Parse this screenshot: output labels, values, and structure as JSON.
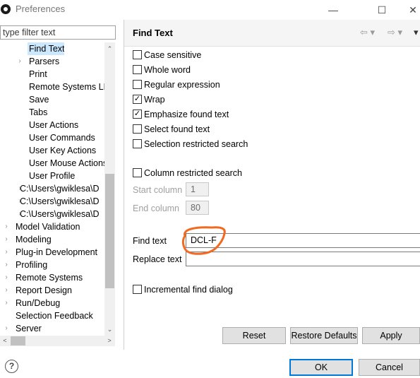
{
  "window": {
    "title": "Preferences",
    "minimize_glyph": "—",
    "maximize_glyph": "☐",
    "close_glyph": "✕"
  },
  "filter": {
    "placeholder": "type filter text"
  },
  "tree": {
    "items": [
      {
        "label": "Find Text",
        "level": 2,
        "arrow": "",
        "selected": true
      },
      {
        "label": "Parsers",
        "level": 2,
        "arrow": "›",
        "selected": false
      },
      {
        "label": "Print",
        "level": 2,
        "arrow": "",
        "selected": false
      },
      {
        "label": "Remote Systems LPEX",
        "level": 2,
        "arrow": "",
        "selected": false
      },
      {
        "label": "Save",
        "level": 2,
        "arrow": "",
        "selected": false
      },
      {
        "label": "Tabs",
        "level": 2,
        "arrow": "",
        "selected": false
      },
      {
        "label": "User Actions",
        "level": 2,
        "arrow": "",
        "selected": false
      },
      {
        "label": "User Commands",
        "level": 2,
        "arrow": "",
        "selected": false
      },
      {
        "label": "User Key Actions",
        "level": 2,
        "arrow": "",
        "selected": false
      },
      {
        "label": "User Mouse Actions",
        "level": 2,
        "arrow": "",
        "selected": false
      },
      {
        "label": "User Profile",
        "level": 2,
        "arrow": "",
        "selected": false
      },
      {
        "label": "C:\\Users\\gwiklesa\\D",
        "level": 1,
        "arrow": "›",
        "selected": false
      },
      {
        "label": "C:\\Users\\gwiklesa\\D",
        "level": 1,
        "arrow": "›",
        "selected": false
      },
      {
        "label": "C:\\Users\\gwiklesa\\D",
        "level": 1,
        "arrow": "›",
        "selected": false
      },
      {
        "label": "Model Validation",
        "level": 0,
        "arrow": "›",
        "selected": false
      },
      {
        "label": "Modeling",
        "level": 0,
        "arrow": "›",
        "selected": false
      },
      {
        "label": "Plug-in Development",
        "level": 0,
        "arrow": "›",
        "selected": false
      },
      {
        "label": "Profiling",
        "level": 0,
        "arrow": "›",
        "selected": false
      },
      {
        "label": "Remote Systems",
        "level": 0,
        "arrow": "›",
        "selected": false
      },
      {
        "label": "Report Design",
        "level": 0,
        "arrow": "›",
        "selected": false
      },
      {
        "label": "Run/Debug",
        "level": 0,
        "arrow": "›",
        "selected": false
      },
      {
        "label": "Selection Feedback",
        "level": 0,
        "arrow": "",
        "selected": false
      },
      {
        "label": "Server",
        "level": 0,
        "arrow": "›",
        "selected": false
      }
    ],
    "scroll_up_glyph": "⌃",
    "scroll_down_glyph": "⌄",
    "scroll_left_glyph": "<",
    "scroll_right_glyph": ">"
  },
  "page": {
    "title": "Find Text",
    "nav_back": "⇦ ▾",
    "nav_forward": "⇨ ▾",
    "menu": "▾",
    "options": [
      {
        "label": "Case sensitive",
        "checked": false
      },
      {
        "label": "Whole word",
        "checked": false
      },
      {
        "label": "Regular expression",
        "checked": false
      },
      {
        "label": "Wrap",
        "checked": true
      },
      {
        "label": "Emphasize found text",
        "checked": true
      },
      {
        "label": "Select found text",
        "checked": false
      },
      {
        "label": "Selection restricted search",
        "checked": false
      }
    ],
    "column_restricted": {
      "label": "Column restricted search",
      "checked": false
    },
    "start_column": {
      "label": "Start column",
      "value": "1"
    },
    "end_column": {
      "label": "End column",
      "value": "80"
    },
    "find_text": {
      "label": "Find text",
      "value": "DCL-F"
    },
    "replace_text": {
      "label": "Replace text",
      "value": ""
    },
    "incremental": {
      "label": "Incremental find dialog",
      "checked": false
    },
    "buttons": {
      "reset": "Reset",
      "restore_defaults": "Restore Defaults",
      "apply": "Apply"
    }
  },
  "footer": {
    "help_glyph": "?",
    "ok": "OK",
    "cancel": "Cancel"
  },
  "colors": {
    "selection": "#cce8ff",
    "annotation": "#f26a21",
    "default_button_border": "#0078d7"
  }
}
